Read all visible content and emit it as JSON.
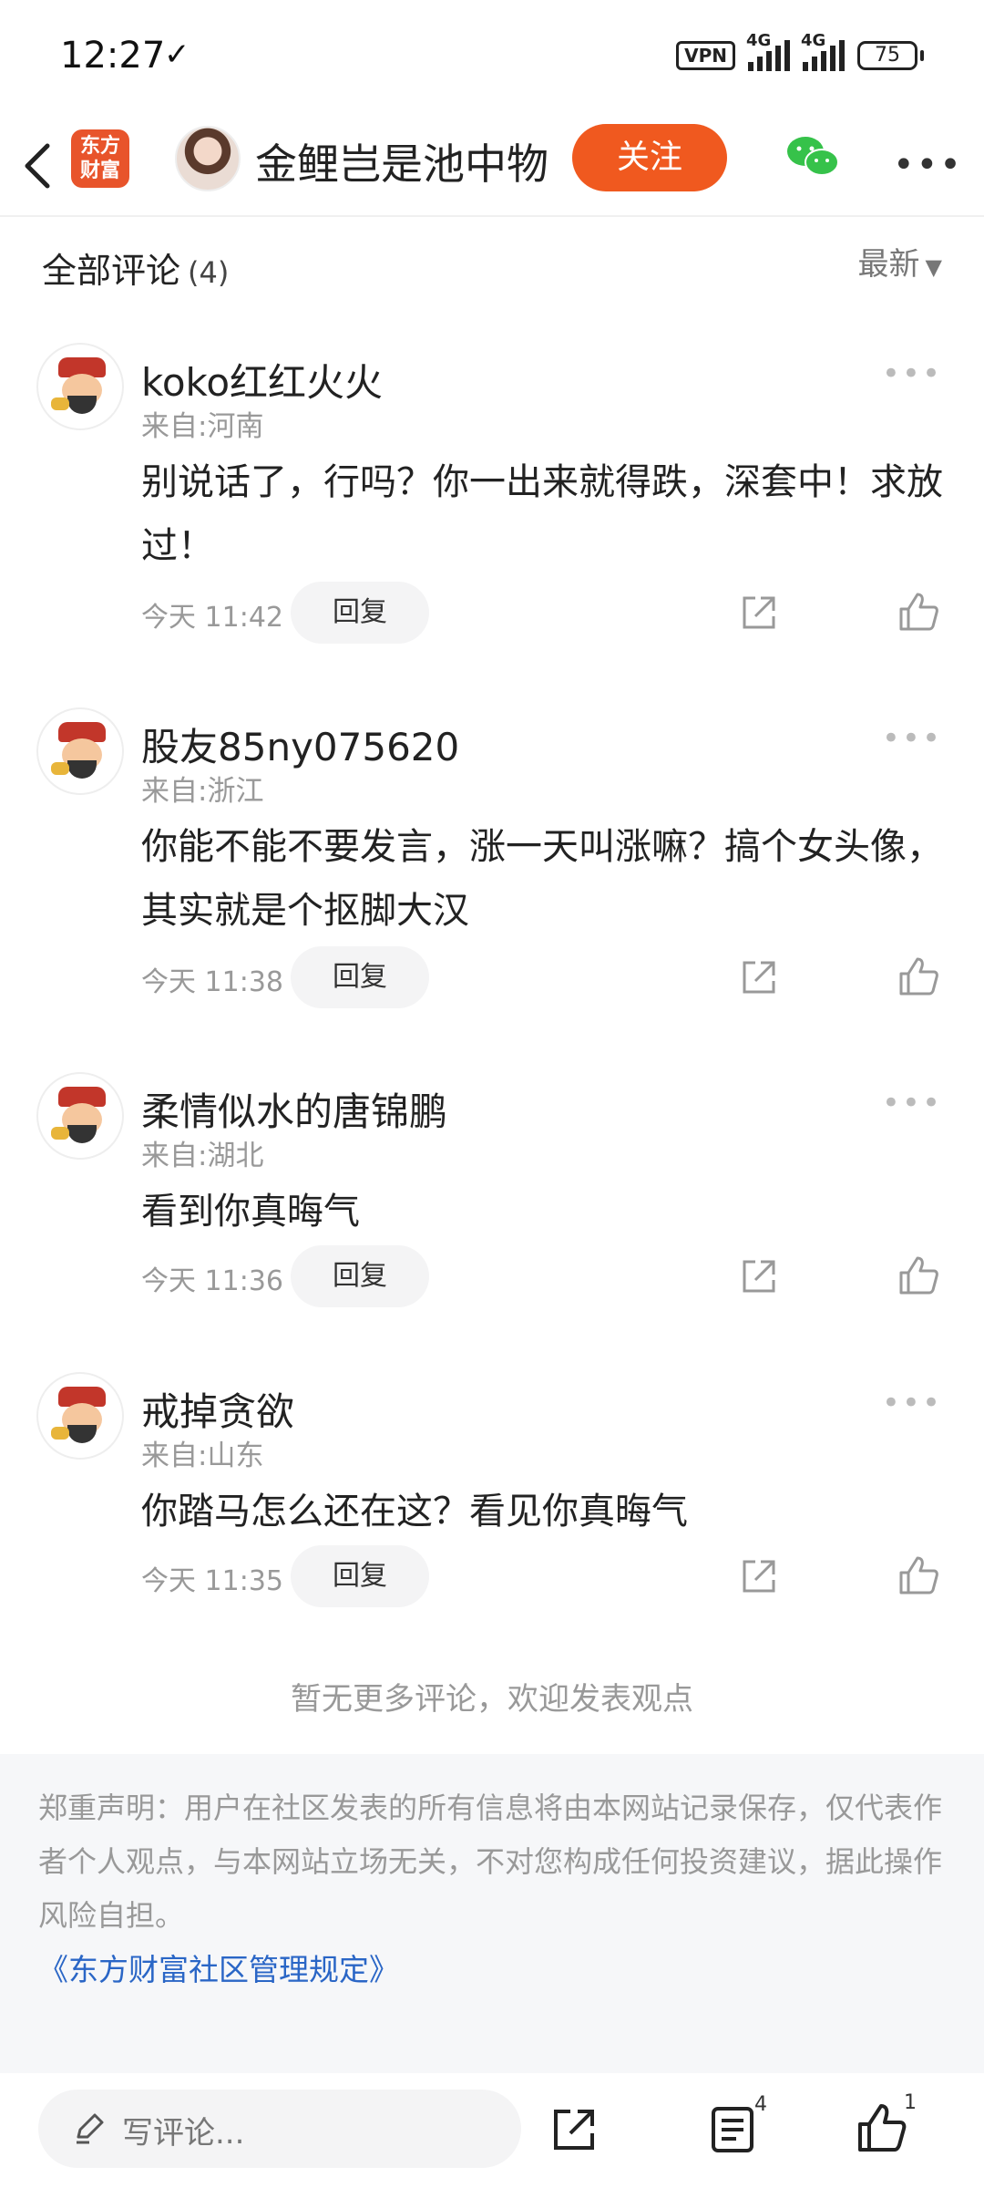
{
  "status_bar": {
    "time": "12:27",
    "vpn": "VPN",
    "network1": "4G",
    "network2": "4G",
    "battery": "75"
  },
  "header": {
    "app_logo_line1": "东方",
    "app_logo_line2": "财富",
    "username": "金鲤岂是池中物",
    "follow_label": "关注"
  },
  "comments_header": {
    "title": "全部评论",
    "count": "(4)",
    "sort_label": "最新"
  },
  "comments": [
    {
      "name": "koko红红火火",
      "location": "来自:河南",
      "text": "别说话了，行吗？你一出来就得跌，深套中！求放过！",
      "time": "今天 11:42",
      "reply_label": "回复"
    },
    {
      "name": "股友85ny075620",
      "location": "来自:浙江",
      "text": "你能不能不要发言，涨一天叫涨嘛？搞个女头像，其实就是个抠脚大汉",
      "time": "今天 11:38",
      "reply_label": "回复"
    },
    {
      "name": "柔情似水的唐锦鹏",
      "location": "来自:湖北",
      "text": "看到你真晦气",
      "time": "今天 11:36",
      "reply_label": "回复"
    },
    {
      "name": "戒掉贪欲",
      "location": "来自:山东",
      "text": "你踏马怎么还在这？看见你真晦气",
      "time": "今天 11:35",
      "reply_label": "回复"
    }
  ],
  "no_more_text": "暂无更多评论，欢迎发表观点",
  "disclaimer": {
    "text": "郑重声明：用户在社区发表的所有信息将由本网站记录保存，仅代表作者个人观点，与本网站立场无关，不对您构成任何投资建议，据此操作风险自担。",
    "link": "《东方财富社区管理规定》"
  },
  "bottom_bar": {
    "input_placeholder": "写评论...",
    "comment_count": "4",
    "like_count": "1"
  },
  "colors": {
    "accent": "#f0591f",
    "link": "#2a66c6",
    "wechat": "#36c24a"
  },
  "icons": [
    "back-arrow-icon",
    "wechat-icon",
    "more-icon",
    "share-icon",
    "like-icon",
    "pen-icon",
    "comments-list-icon"
  ]
}
